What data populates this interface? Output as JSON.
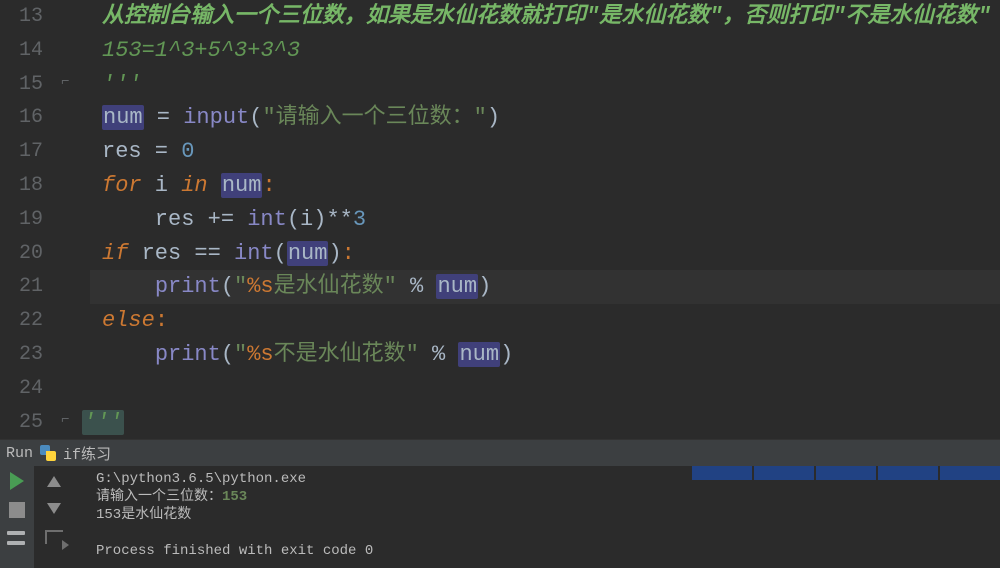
{
  "gutter": [
    "13",
    "14",
    "15",
    "16",
    "17",
    "18",
    "19",
    "20",
    "21",
    "22",
    "23",
    "24",
    "25"
  ],
  "code": {
    "l13_a": "从控制台输入一个三位数，如果是水仙花数就打印\"是水仙花数\"，否则打印\"不是水仙花数\"",
    "l14_a": "153",
    "l14_b": "=",
    "l14_c": "1",
    "l14_d": "^",
    "l14_e": "3",
    "l14_f": "+",
    "l14_g": "5",
    "l14_h": "^",
    "l14_i": "3",
    "l14_j": "+",
    "l14_k": "3",
    "l14_l": "^",
    "l14_m": "3",
    "l15": "'''",
    "l16_var": "num",
    "l16_eq": " = ",
    "l16_fn": "input",
    "l16_p1": "(",
    "l16_str": "\"请输入一个三位数：\"",
    "l16_p2": ")",
    "l17_a": "res = ",
    "l17_b": "0",
    "l18_for": "for",
    "l18_sp1": " i ",
    "l18_in": "in",
    "l18_sp2": " ",
    "l18_var": "num",
    "l18_col": ":",
    "l19_a": "    res += ",
    "l19_int": "int",
    "l19_b": "(i)**",
    "l19_c": "3",
    "l20_if": "if",
    "l20_a": " res == ",
    "l20_int": "int",
    "l20_p1": "(",
    "l20_var": "num",
    "l20_p2": ")",
    "l20_col": ":",
    "l21_a": "    ",
    "l21_print": "print",
    "l21_p1": "(",
    "l21_s1": "\"",
    "l21_fmt": "%s",
    "l21_s2": "是水仙花数\"",
    "l21_pct": " % ",
    "l21_var": "num",
    "l21_p2": ")",
    "l22_else": "else",
    "l22_col": ":",
    "l23_a": "    ",
    "l23_print": "print",
    "l23_p1": "(",
    "l23_s1": "\"",
    "l23_fmt": "%s",
    "l23_s2": "不是水仙花数\"",
    "l23_pct": " % ",
    "l23_var": "num",
    "l23_p2": ")",
    "l25": "'''"
  },
  "runbar": {
    "run": "Run",
    "file": "if练习"
  },
  "console": {
    "path": "G:\\python3.6.5\\python.exe",
    "prompt": "请输入一个三位数：",
    "input": "153",
    "result": "153是水仙花数",
    "exit": "Process finished with exit code 0"
  }
}
